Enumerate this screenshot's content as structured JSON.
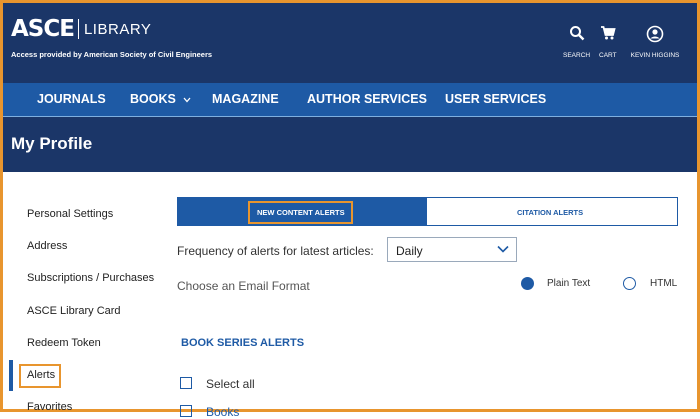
{
  "header": {
    "logo_asce": "ASCE",
    "logo_library": "LIBRARY",
    "access_text": "Access provided by American Society of Civil Engineers",
    "search_label": "SEARCH",
    "cart_label": "CART",
    "user_label": "KEVIN HIGGINS"
  },
  "nav": {
    "items": [
      "JOURNALS",
      "BOOKS",
      "MAGAZINE",
      "AUTHOR SERVICES",
      "USER SERVICES"
    ]
  },
  "page": {
    "title": "My Profile"
  },
  "sidebar": {
    "items": [
      "Personal Settings",
      "Address",
      "Subscriptions / Purchases",
      "ASCE Library Card",
      "Redeem Token",
      "Alerts",
      "Favorites"
    ],
    "active": "Alerts"
  },
  "alerts": {
    "tabs": [
      "NEW CONTENT ALERTS",
      "CITATION ALERTS"
    ],
    "active_tab": "NEW CONTENT ALERTS",
    "frequency_label": "Frequency of alerts for latest articles:",
    "frequency_value": "Daily",
    "email_format_label": "Choose an Email Format",
    "format_options": [
      "Plain Text",
      "HTML"
    ],
    "format_selected": "Plain Text"
  },
  "book_series": {
    "title": "BOOK SERIES ALERTS",
    "select_all": "Select all",
    "first_item": "Books"
  },
  "colors": {
    "navy": "#1b3668",
    "nav_blue": "#1e5aa5",
    "highlight_orange": "#e8952e"
  }
}
